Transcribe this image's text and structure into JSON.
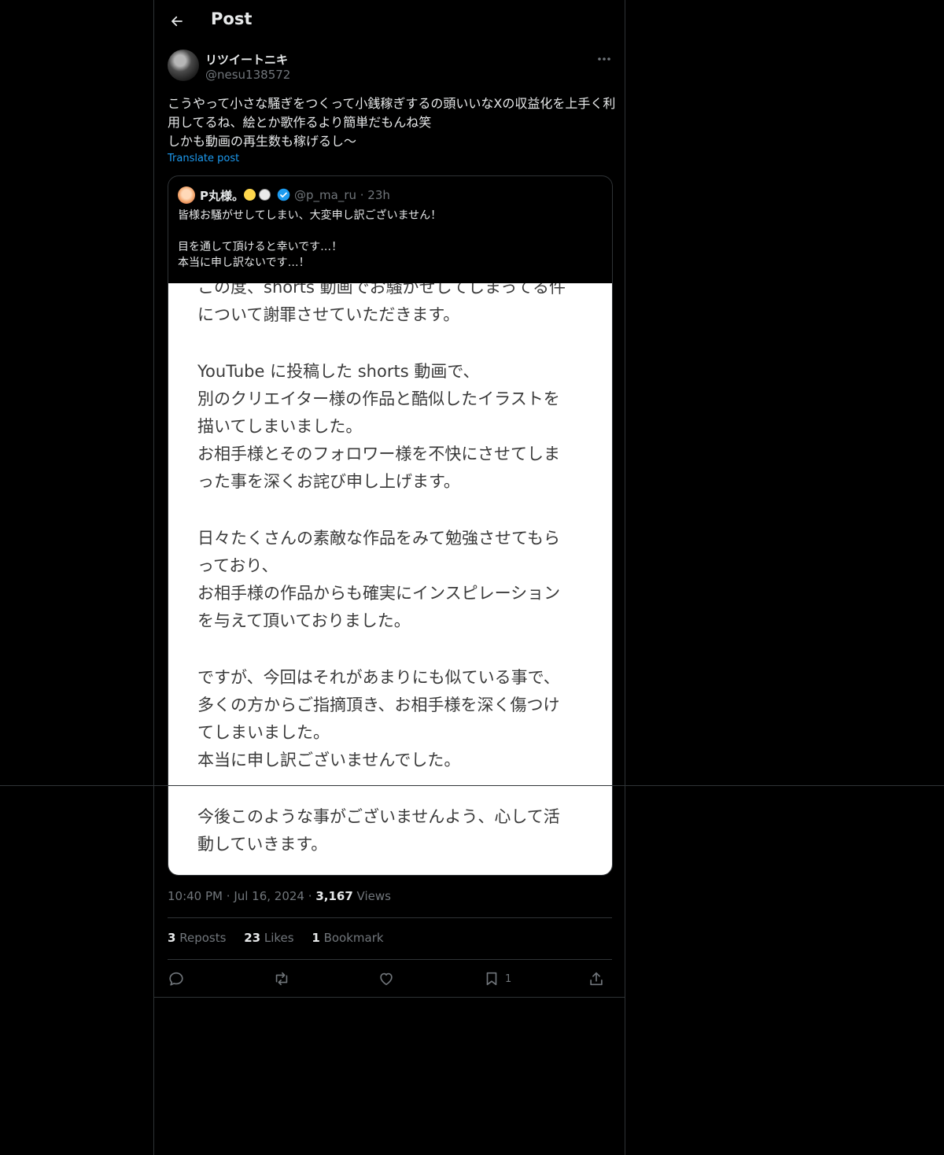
{
  "header": {
    "title": "Post"
  },
  "author": {
    "name": "リツイートニキ",
    "handle": "@nesu138572"
  },
  "post": {
    "text": "こうやって小さな騒ぎをつくって小銭稼ぎするの頭いいなXの収益化を上手く利用してるね、絵とか歌作るより簡単だもんね笑\nしかも動画の再生数も稼げるし〜",
    "translate_label": "Translate post"
  },
  "quote": {
    "name": "P丸様。",
    "handle_time": "@p_ma_ru · 23h",
    "text": "皆様お騒がせしてしまい、大変申し訳ございません！\n\n目を通して頂けると幸いです…！\n本当に申し訳ないです…！",
    "image_paragraphs": [
      "この度、shorts 動画でお騒がせしてしまってる件\nについて謝罪させていただきます。",
      "YouTube に投稿した shorts 動画で、\n別のクリエイター様の作品と酷似したイラストを\n描いてしまいました。\nお相手様とそのフォロワー様を不快にさせてしま\nった事を深くお詫び申し上げます。",
      "日々たくさんの素敵な作品をみて勉強させてもら\nっており、\nお相手様の作品からも確実にインスピレーション\nを与えて頂いておりました。",
      "ですが、今回はそれがあまりにも似ている事で、\n多くの方からご指摘頂き、お相手様を深く傷つけ\nてしまいました。\n本当に申し訳ございませんでした。",
      "今後このような事がございませんよう、心して活\n動していきます。"
    ]
  },
  "meta": {
    "time": "10:40 PM",
    "date": "Jul 16, 2024",
    "views_count": "3,167",
    "views_label": "Views"
  },
  "stats": {
    "reposts_count": "3",
    "reposts_label": "Reposts",
    "likes_count": "23",
    "likes_label": "Likes",
    "bookmarks_count": "1",
    "bookmarks_label": "Bookmark"
  },
  "actions": {
    "bookmark_count": "1"
  },
  "icons": [
    "back-arrow-icon",
    "more-icon",
    "verified-badge-icon",
    "reply-icon",
    "repost-icon",
    "like-icon",
    "bookmark-icon",
    "share-icon"
  ],
  "colors": {
    "background": "#000000",
    "text": "#e7e9ea",
    "secondary": "#71767b",
    "accent": "#1d9bf0",
    "border": "#2f3336"
  }
}
